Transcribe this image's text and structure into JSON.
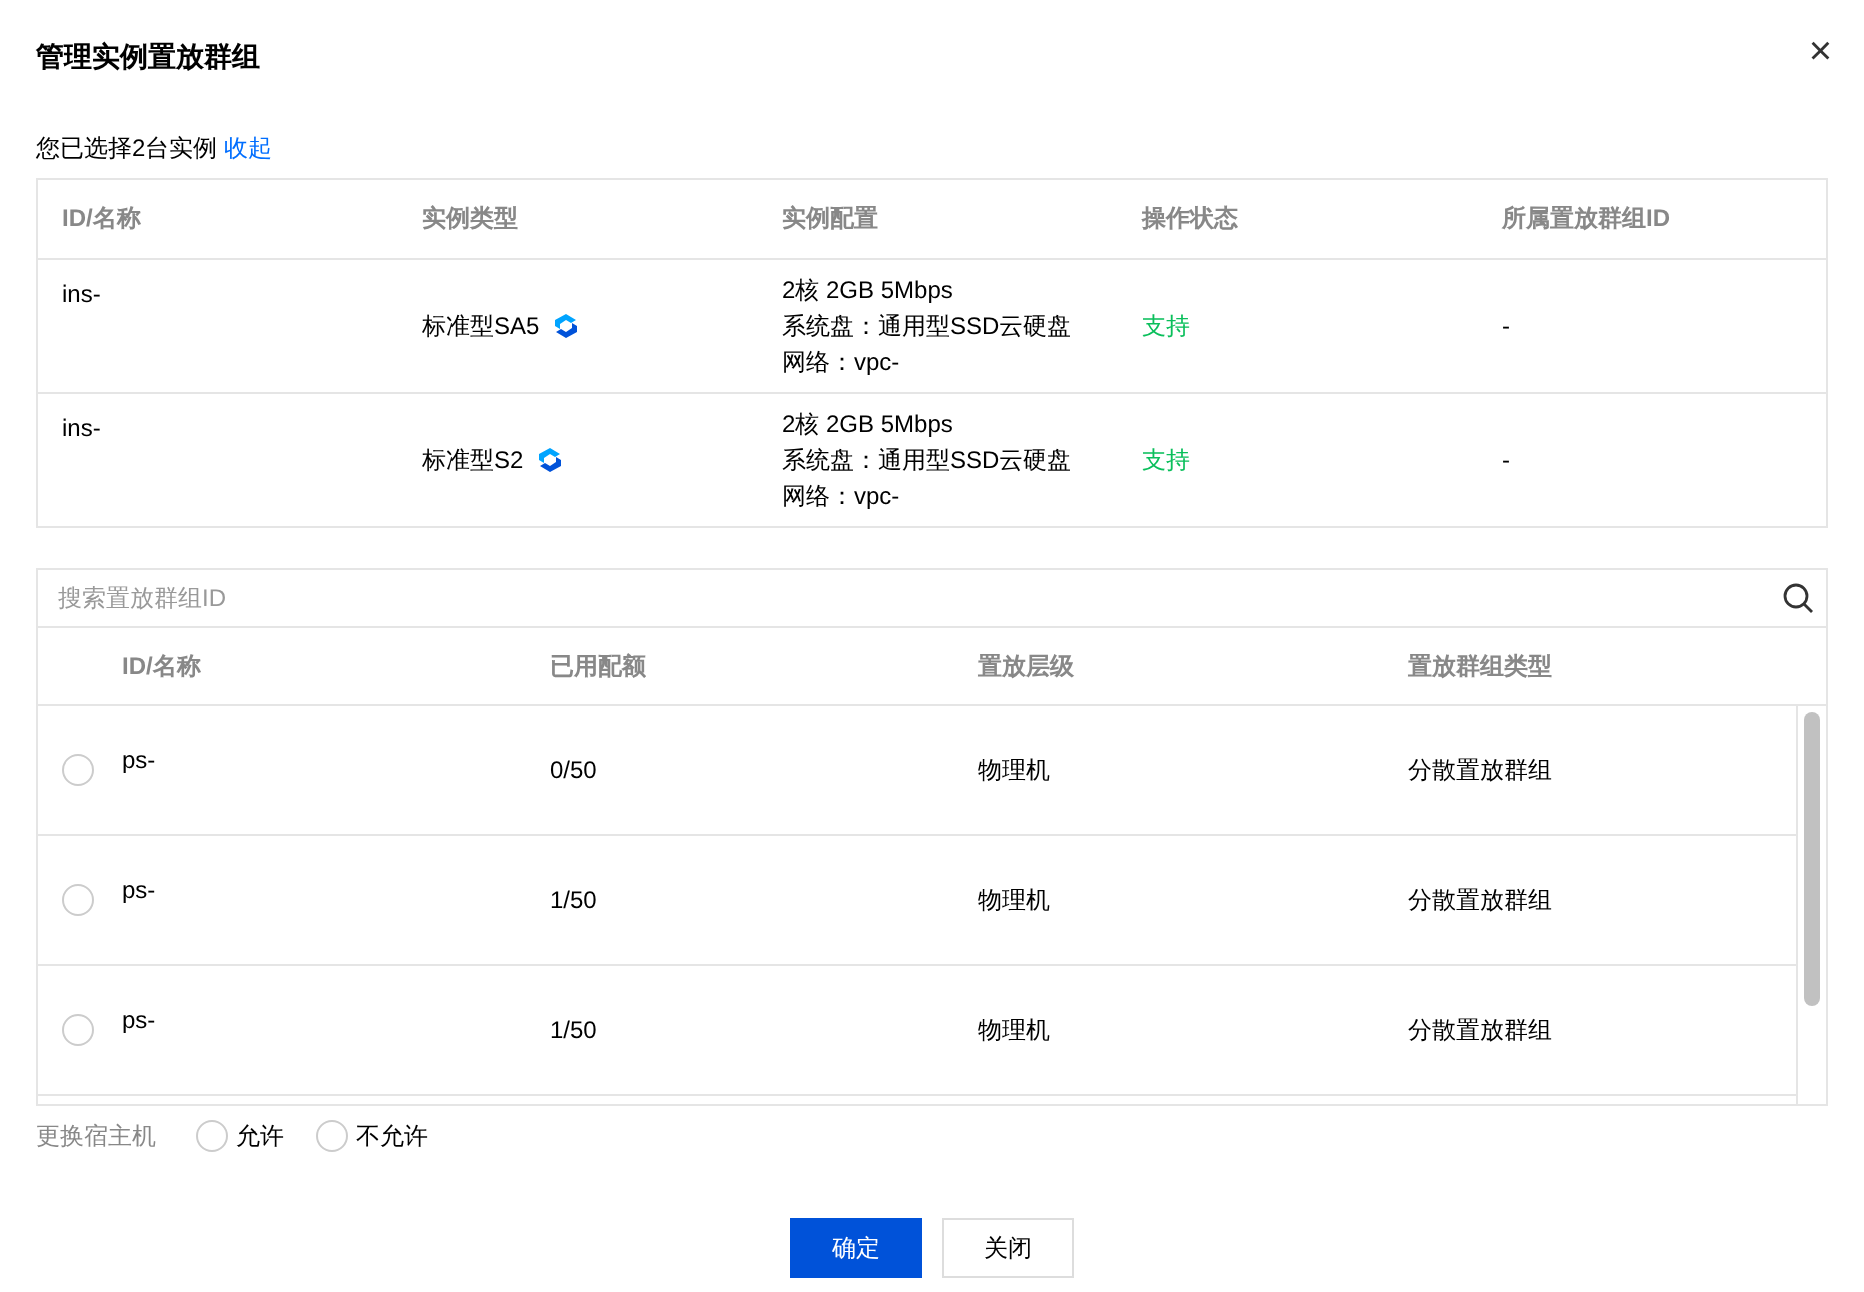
{
  "dialog": {
    "title": "管理实例置放群组",
    "close": "×"
  },
  "selection": {
    "text": "您已选择2台实例",
    "link": "收起"
  },
  "instances": {
    "columns": [
      "ID/名称",
      "实例类型",
      "实例配置",
      "操作状态",
      "所属置放群组ID"
    ],
    "rows": [
      {
        "id": "ins-",
        "type": "标准型SA5",
        "config": [
          "2核 2GB 5Mbps",
          "系统盘：通用型SSD云硬盘",
          "网络：vpc-"
        ],
        "status": "支持",
        "group": "-"
      },
      {
        "id": "ins-",
        "type": "标准型S2",
        "config": [
          "2核 2GB 5Mbps",
          "系统盘：通用型SSD云硬盘",
          "网络：vpc-"
        ],
        "status": "支持",
        "group": "-"
      }
    ]
  },
  "search": {
    "placeholder": "搜索置放群组ID"
  },
  "groups": {
    "columns": [
      "ID/名称",
      "已用配额",
      "置放层级",
      "置放群组类型"
    ],
    "rows": [
      {
        "selected": false,
        "id": "ps-",
        "quota": "0/50",
        "level_name": "物理机",
        "type": "分散置放群组"
      },
      {
        "selected": false,
        "id": "ps-",
        "quota": "1/50",
        "level_name": "物理机",
        "type": "分散置放群组"
      },
      {
        "selected": false,
        "id": "ps-",
        "quota": "1/50",
        "level_name": "物理机",
        "type": "分散置放群组"
      }
    ]
  },
  "host_change": {
    "label": "更换宿主机",
    "options": [
      {
        "label": "允许",
        "selected": false
      },
      {
        "label": "不允许",
        "selected": false
      }
    ]
  },
  "buttons": [
    {
      "label": "确定",
      "kind": "primary"
    },
    {
      "label": "关闭",
      "kind": "secondary"
    }
  ]
}
